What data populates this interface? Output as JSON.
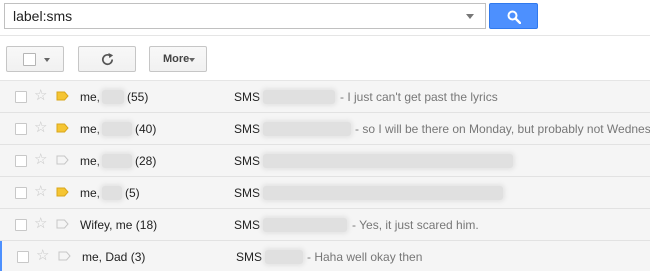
{
  "search": {
    "value": "label:sms"
  },
  "toolbar": {
    "more_label": "More"
  },
  "colors": {
    "accent": "#4d90fe",
    "label_tag_yellow": "#f5c533",
    "row_bg": "#f5f5f5"
  },
  "threads": [
    {
      "sender_prefix": "me,",
      "sender_count": "(55)",
      "label": "SMS",
      "snippet": "- I just can't get past the lyrics",
      "tagged": true,
      "active": false
    },
    {
      "sender_prefix": "me,",
      "sender_count": "(40)",
      "label": "SMS",
      "snippet": "- so I will be there on Monday, but probably not Wednesday",
      "tagged": true,
      "active": false
    },
    {
      "sender_prefix": "me,",
      "sender_count": "(28)",
      "label": "SMS",
      "snippet": "",
      "tagged": false,
      "active": false
    },
    {
      "sender_prefix": "me,",
      "sender_count": "(5)",
      "label": "SMS",
      "snippet": "",
      "tagged": true,
      "active": false
    },
    {
      "sender_prefix": "Wifey, me",
      "sender_count": "(18)",
      "label": "SMS",
      "snippet": "- Yes, it just scared him.",
      "tagged": false,
      "active": false
    },
    {
      "sender_prefix": "me, Dad",
      "sender_count": "(3)",
      "label": "SMS",
      "snippet": "- Haha well okay then",
      "tagged": false,
      "active": true
    }
  ]
}
